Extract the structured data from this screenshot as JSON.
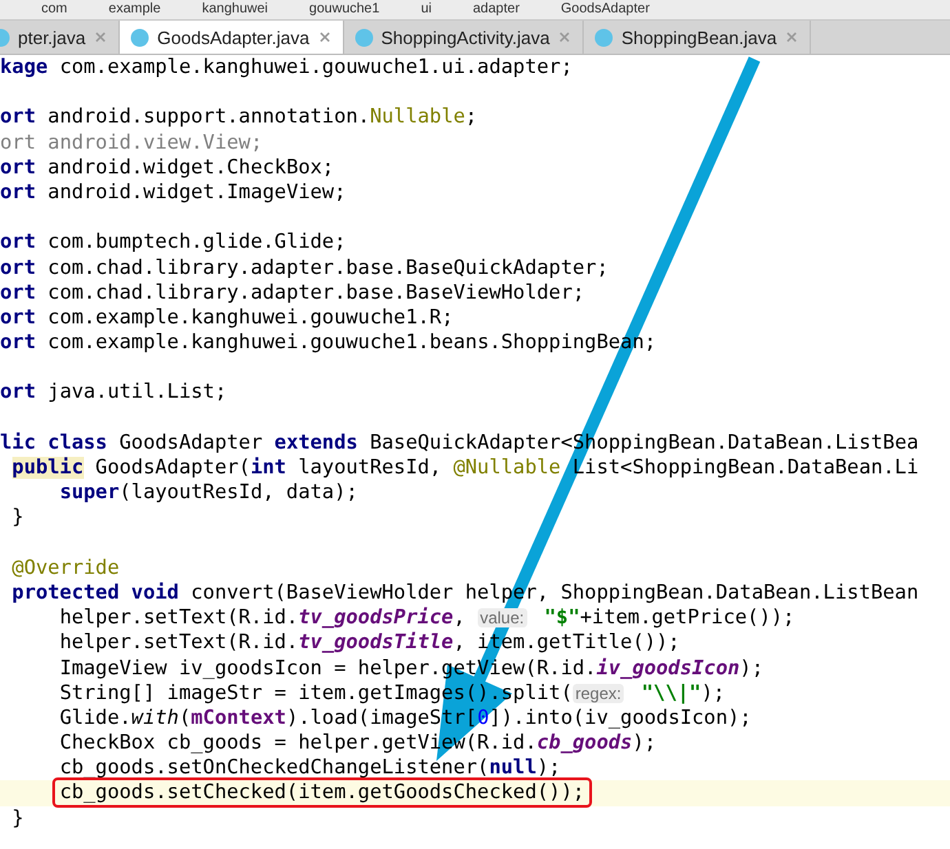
{
  "breadcrumbs": [
    "com",
    "example",
    "kanghuwei",
    "gouwuche1",
    "ui",
    "adapter",
    "GoodsAdapter"
  ],
  "tabs": [
    {
      "label": "pter.java",
      "selected": false
    },
    {
      "label": "GoodsAdapter.java",
      "selected": true
    },
    {
      "label": "ShoppingActivity.java",
      "selected": false
    },
    {
      "label": "ShoppingBean.java",
      "selected": false
    }
  ],
  "code_lines": [
    {
      "kind": "top",
      "tokens": [
        {
          "kind": "kw",
          "text": "kage"
        },
        {
          "kind": "plain",
          "text": " com.example.kanghuwei.gouwuche1.ui.adapter;"
        }
      ]
    },
    {
      "kind": "blank"
    },
    {
      "kind": "top",
      "tokens": [
        {
          "kind": "kw",
          "text": "ort"
        },
        {
          "kind": "plain",
          "text": " android.support.annotation."
        },
        {
          "kind": "annotation",
          "text": "Nullable"
        },
        {
          "kind": "plain",
          "text": ";"
        }
      ]
    },
    {
      "kind": "top",
      "tokens": [
        {
          "kind": "unused",
          "text": "ort android.view.View;"
        }
      ]
    },
    {
      "kind": "top",
      "tokens": [
        {
          "kind": "kw",
          "text": "ort"
        },
        {
          "kind": "plain",
          "text": " android.widget.CheckBox;"
        }
      ]
    },
    {
      "kind": "top",
      "tokens": [
        {
          "kind": "kw",
          "text": "ort"
        },
        {
          "kind": "plain",
          "text": " android.widget.ImageView;"
        }
      ]
    },
    {
      "kind": "blank"
    },
    {
      "kind": "top",
      "tokens": [
        {
          "kind": "kw",
          "text": "ort"
        },
        {
          "kind": "plain",
          "text": " com.bumptech.glide.Glide;"
        }
      ]
    },
    {
      "kind": "top",
      "tokens": [
        {
          "kind": "kw",
          "text": "ort"
        },
        {
          "kind": "plain",
          "text": " com.chad.library.adapter.base.BaseQuickAdapter;"
        }
      ]
    },
    {
      "kind": "top",
      "tokens": [
        {
          "kind": "kw",
          "text": "ort"
        },
        {
          "kind": "plain",
          "text": " com.chad.library.adapter.base.BaseViewHolder;"
        }
      ]
    },
    {
      "kind": "top",
      "tokens": [
        {
          "kind": "kw",
          "text": "ort"
        },
        {
          "kind": "plain",
          "text": " com.example.kanghuwei.gouwuche1.R;"
        }
      ]
    },
    {
      "kind": "top",
      "tokens": [
        {
          "kind": "kw",
          "text": "ort"
        },
        {
          "kind": "plain",
          "text": " com.example.kanghuwei.gouwuche1.beans.ShoppingBean;"
        }
      ]
    },
    {
      "kind": "blank"
    },
    {
      "kind": "top",
      "tokens": [
        {
          "kind": "kw",
          "text": "ort"
        },
        {
          "kind": "plain",
          "text": " java.util.List;"
        }
      ]
    },
    {
      "kind": "blank"
    },
    {
      "kind": "top",
      "tokens": [
        {
          "kind": "kw",
          "text": "lic class"
        },
        {
          "kind": "plain",
          "text": " GoodsAdapter "
        },
        {
          "kind": "kw",
          "text": "extends"
        },
        {
          "kind": "plain",
          "text": " BaseQuickAdapter<ShoppingBean.DataBean.ListBea"
        }
      ]
    },
    {
      "kind": "member",
      "tokens": [
        {
          "kind": "kw_marked",
          "text": "public"
        },
        {
          "kind": "plain",
          "text": " GoodsAdapter("
        },
        {
          "kind": "kw",
          "text": "int"
        },
        {
          "kind": "plain",
          "text": " layoutResId, "
        },
        {
          "kind": "annotation",
          "text": "@Nullable"
        },
        {
          "kind": "plain",
          "text": " List<ShoppingBean.DataBean.Li"
        }
      ]
    },
    {
      "kind": "statement",
      "tokens": [
        {
          "kind": "kw",
          "text": "super"
        },
        {
          "kind": "plain",
          "text": "(layoutResId, data);"
        }
      ]
    },
    {
      "kind": "member",
      "tokens": [
        {
          "kind": "plain",
          "text": "}"
        }
      ]
    },
    {
      "kind": "blank"
    },
    {
      "kind": "member",
      "tokens": [
        {
          "kind": "annotation",
          "text": "@Override"
        }
      ]
    },
    {
      "kind": "member",
      "tokens": [
        {
          "kind": "kw",
          "text": "protected void"
        },
        {
          "kind": "plain",
          "text": " convert(BaseViewHolder helper, ShoppingBean.DataBean.ListBean"
        }
      ]
    },
    {
      "kind": "statement",
      "tokens": [
        {
          "kind": "plain",
          "text": "helper.setText(R.id."
        },
        {
          "kind": "field",
          "text": "tv_goodsPrice"
        },
        {
          "kind": "plain",
          "text": ", "
        },
        {
          "kind": "hint",
          "text": "value:"
        },
        {
          "kind": "string",
          "text": " \"$\""
        },
        {
          "kind": "plain",
          "text": "+item.getPrice());"
        }
      ]
    },
    {
      "kind": "statement",
      "tokens": [
        {
          "kind": "plain",
          "text": "helper.setText(R.id."
        },
        {
          "kind": "field",
          "text": "tv_goodsTitle"
        },
        {
          "kind": "plain",
          "text": ", item.getTitle());"
        }
      ]
    },
    {
      "kind": "statement",
      "tokens": [
        {
          "kind": "plain",
          "text": "ImageView iv_goodsIcon = helper.getView(R.id."
        },
        {
          "kind": "field",
          "text": "iv_goodsIcon"
        },
        {
          "kind": "plain",
          "text": ");"
        }
      ]
    },
    {
      "kind": "statement",
      "tokens": [
        {
          "kind": "plain",
          "text": "String[] imageStr = item.getImages().split("
        },
        {
          "kind": "hint",
          "text": "regex:"
        },
        {
          "kind": "string",
          "text": " \"\\\\|\""
        },
        {
          "kind": "plain",
          "text": ");"
        }
      ]
    },
    {
      "kind": "statement",
      "tokens": [
        {
          "kind": "plain",
          "text": "Glide."
        },
        {
          "kind": "static",
          "text": "with"
        },
        {
          "kind": "plain",
          "text": "("
        },
        {
          "kind": "member",
          "text": "mContext"
        },
        {
          "kind": "plain",
          "text": ").load(imageStr["
        },
        {
          "kind": "number",
          "text": "0"
        },
        {
          "kind": "plain",
          "text": "]).into(iv_goodsIcon);"
        }
      ]
    },
    {
      "kind": "statement",
      "tokens": [
        {
          "kind": "plain",
          "text": "CheckBox cb_goods = helper.getView(R.id."
        },
        {
          "kind": "field",
          "text": "cb_goods"
        },
        {
          "kind": "plain",
          "text": ");"
        }
      ]
    },
    {
      "kind": "statement",
      "tokens": [
        {
          "kind": "plain",
          "text": "cb_goods.setOnCheckedChangeListener("
        },
        {
          "kind": "kw",
          "text": "null"
        },
        {
          "kind": "plain",
          "text": ");"
        }
      ]
    },
    {
      "kind": "statement",
      "current": true,
      "boxed": true,
      "tokens": [
        {
          "kind": "plain",
          "text": "cb_goods.setChecked(item.getGoodsChecked());"
        }
      ]
    },
    {
      "kind": "member",
      "tokens": [
        {
          "kind": "plain",
          "text": "}"
        }
      ]
    }
  ]
}
